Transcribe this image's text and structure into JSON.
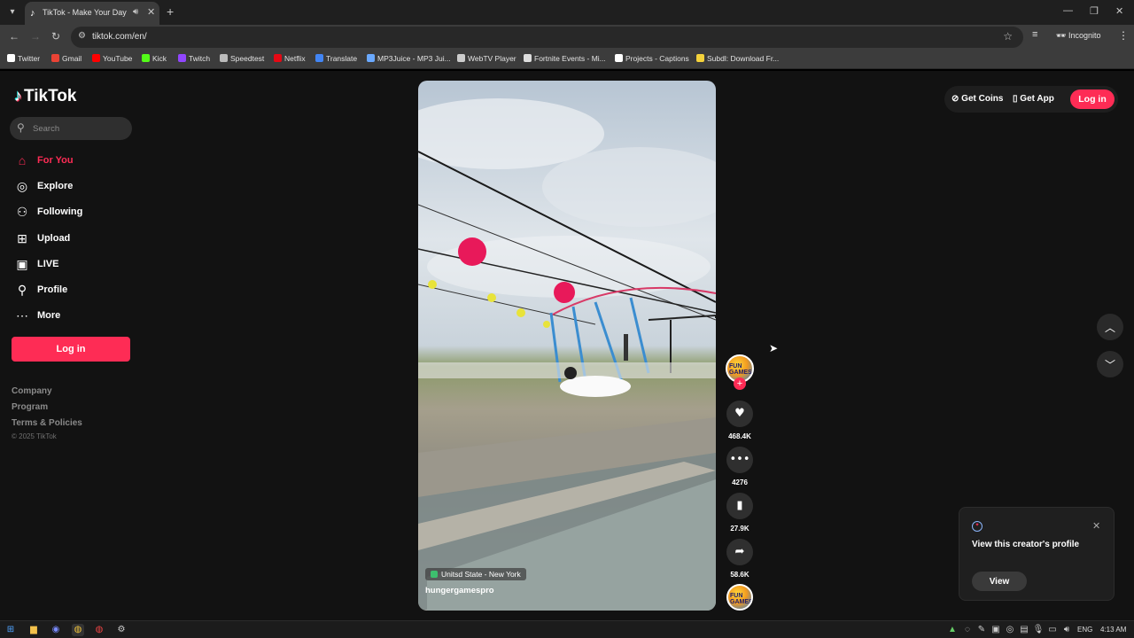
{
  "browser": {
    "tab_title": "TikTok - Make Your Day",
    "url": "tiktok.com/en/",
    "profile_label": "Incognito",
    "bookmarks": [
      {
        "label": "Twitter",
        "color": "#ffffff"
      },
      {
        "label": "Gmail",
        "color": "#ea4335"
      },
      {
        "label": "YouTube",
        "color": "#ff0000"
      },
      {
        "label": "Kick",
        "color": "#53fc18"
      },
      {
        "label": "Twitch",
        "color": "#9146ff"
      },
      {
        "label": "Speedtest",
        "color": "#bbbbbb"
      },
      {
        "label": "Netflix",
        "color": "#e50914"
      },
      {
        "label": "Translate",
        "color": "#4285f4"
      },
      {
        "label": "MP3Juice - MP3 Jui...",
        "color": "#6aa9ff"
      },
      {
        "label": "WebTV Player",
        "color": "#cccccc"
      },
      {
        "label": "Fortnite Events - Mi...",
        "color": "#dddddd"
      },
      {
        "label": "Projects - Captions",
        "color": "#ffffff"
      },
      {
        "label": "Subdl: Download Fr...",
        "color": "#f4d23b"
      }
    ]
  },
  "sidebar": {
    "logo_text": "TikTok",
    "search_placeholder": "Search",
    "nav": [
      {
        "label": "For You",
        "icon": "home-icon",
        "glyph": "⌂"
      },
      {
        "label": "Explore",
        "icon": "compass-icon",
        "glyph": "◎"
      },
      {
        "label": "Following",
        "icon": "following-icon",
        "glyph": "⚇"
      },
      {
        "label": "Upload",
        "icon": "upload-icon",
        "glyph": "⊞"
      },
      {
        "label": "LIVE",
        "icon": "live-icon",
        "glyph": "▣"
      },
      {
        "label": "Profile",
        "icon": "profile-icon",
        "glyph": "⚲"
      },
      {
        "label": "More",
        "icon": "more-icon",
        "glyph": "⋯"
      }
    ],
    "login_label": "Log in",
    "footer_links": [
      "Company",
      "Program",
      "Terms & Policies"
    ],
    "copyright": "© 2025 TikTok"
  },
  "video": {
    "location": "Unitsd State - New York",
    "author": "hungergamespro"
  },
  "actions": {
    "likes": "468.4K",
    "comments": "4276",
    "saves": "27.9K",
    "shares": "58.6K",
    "avatar_text": "FUN GAMES"
  },
  "topbar": {
    "get_coins": "Get Coins",
    "get_app": "Get App",
    "login": "Log in"
  },
  "popup": {
    "text": "View this creator's profile",
    "button": "View"
  },
  "taskbar": {
    "language": "ENG",
    "time": "4:13 AM"
  },
  "colors": {
    "accent": "#fe2c55",
    "background": "#121212"
  }
}
